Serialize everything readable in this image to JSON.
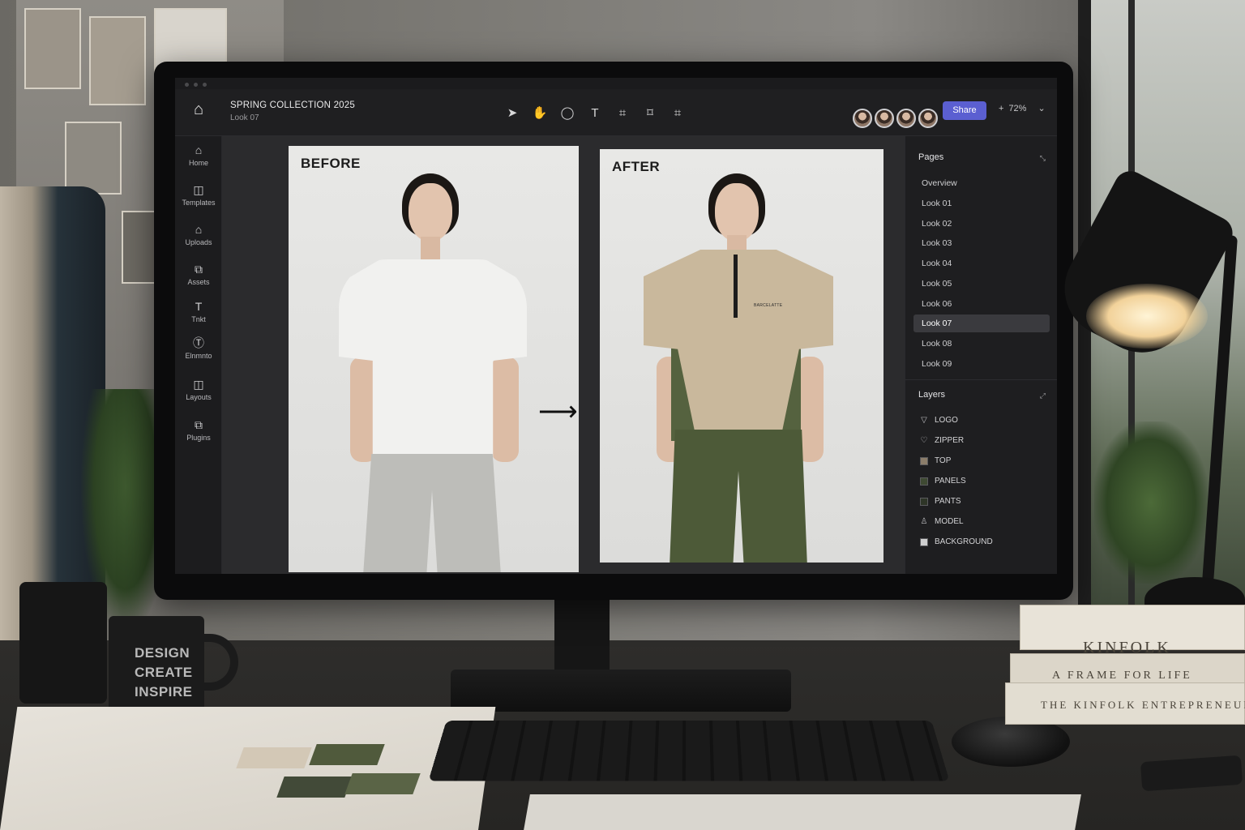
{
  "app": {
    "document_title": "SPRING COLLECTION 2025",
    "document_subtitle": "Look 07",
    "share_label": "Share",
    "zoom_level": "72%",
    "zoom_prefix": "+",
    "zoom_caret": "⌄",
    "logo_glyph": "⌂"
  },
  "toolbar": {
    "tools": [
      {
        "name": "select-tool",
        "glyph": "➤"
      },
      {
        "name": "hand-tool",
        "glyph": "✋"
      },
      {
        "name": "ellipse-tool",
        "glyph": "◯"
      },
      {
        "name": "text-tool",
        "glyph": "T"
      },
      {
        "name": "frame-tool",
        "glyph": "⌗"
      },
      {
        "name": "crop-tool",
        "glyph": "⌑"
      },
      {
        "name": "transform-tool",
        "glyph": "⌗"
      }
    ]
  },
  "sidebar": {
    "items": [
      {
        "label": "Home",
        "glyph": "⌂"
      },
      {
        "label": "Templates",
        "glyph": "◫"
      },
      {
        "label": "Uploads",
        "glyph": "⌂"
      },
      {
        "label": "Assets",
        "glyph": "⧉"
      },
      {
        "label": "Tnkt",
        "glyph": "T"
      },
      {
        "label": "Elnmnto",
        "glyph": "Ⓣ"
      },
      {
        "label": "Layouts",
        "glyph": "◫"
      },
      {
        "label": "Plugins",
        "glyph": "⧉"
      }
    ]
  },
  "canvas": {
    "before_label": "BEFORE",
    "after_label": "AFTER",
    "arrow_glyph": "⟶",
    "shirt_print": "BARCELATTE"
  },
  "pages_panel": {
    "title": "Pages",
    "header_icon": "⤡",
    "items": [
      "Overview",
      "Look 01",
      "Look 02",
      "Look 03",
      "Look 04",
      "Look 05",
      "Look 06",
      "Look 07",
      "Look 08",
      "Look 09"
    ],
    "active_index": 7
  },
  "layers_panel": {
    "title": "Layers",
    "header_icon": "⤢",
    "items": [
      {
        "label": "LOGO",
        "icon": "triangle-icon",
        "glyph": "▽"
      },
      {
        "label": "ZIPPER",
        "icon": "shape-icon",
        "glyph": "♡"
      },
      {
        "label": "TOP",
        "icon": "swatch",
        "color": "#8b7d6a"
      },
      {
        "label": "PANELS",
        "icon": "swatch",
        "color": "#3f4a33"
      },
      {
        "label": "PANTS",
        "icon": "swatch",
        "color": "#2e3527"
      },
      {
        "label": "MODEL",
        "icon": "person-icon",
        "glyph": "♙"
      },
      {
        "label": "BACKGROUND",
        "icon": "swatch",
        "color": "#cfcfcf"
      }
    ]
  },
  "desk": {
    "mug_lines": [
      "DESIGN",
      "CREATE",
      "INSPIRE"
    ],
    "books": [
      "KINFOLK",
      "A FRAME FOR LIFE",
      "THE KINFOLK ENTREPRENEUR"
    ]
  },
  "colors": {
    "accent": "#5b5fd1",
    "beige_top": "#c9b89c",
    "olive": "#55623f",
    "white_tee": "#f1f1ef",
    "grey_pants": "#bdbdb9"
  }
}
